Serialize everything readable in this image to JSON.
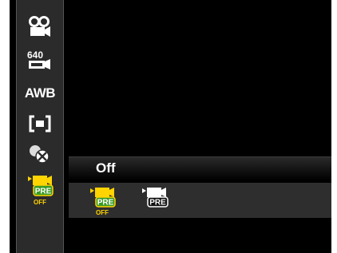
{
  "sidebar": {
    "items": [
      {
        "icon": "movie-camera-icon"
      },
      {
        "icon": "resolution-640-icon",
        "label": "640"
      },
      {
        "icon": "white-balance-icon",
        "label": "AWB"
      },
      {
        "icon": "focus-area-icon"
      },
      {
        "icon": "effect-off-icon"
      },
      {
        "icon": "pre-record-icon",
        "badge": "PRE",
        "state": "OFF",
        "selected": true
      }
    ]
  },
  "panel": {
    "title": "Off",
    "options": [
      {
        "icon": "pre-record-off-icon",
        "badge": "PRE",
        "state": "OFF",
        "selected": true
      },
      {
        "icon": "pre-record-on-icon",
        "badge": "PRE",
        "selected": false
      }
    ]
  },
  "colors": {
    "accent": "#ffd400",
    "badge_green": "#3a9a24",
    "sidebar_bg": "#2b2b2b"
  }
}
